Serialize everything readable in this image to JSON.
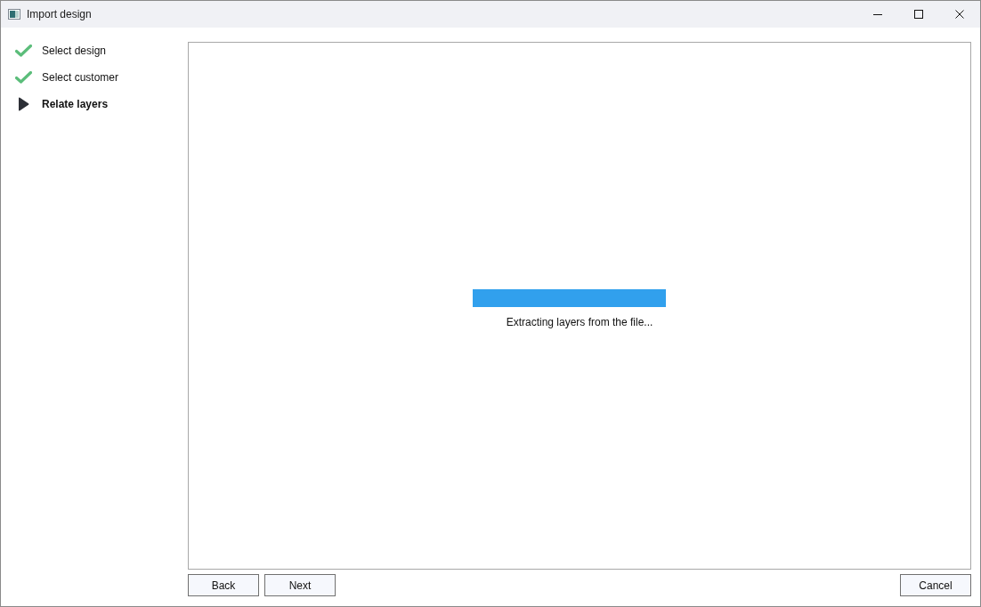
{
  "window": {
    "title": "Import design"
  },
  "steps": [
    {
      "label": "Select design",
      "kind": "done"
    },
    {
      "label": "Select customer",
      "kind": "done"
    },
    {
      "label": "Relate layers",
      "kind": "current"
    }
  ],
  "progress": {
    "level": 1,
    "message": "Extracting layers from the file..."
  },
  "nav_buttons": [
    "Back",
    "Next"
  ],
  "cancel_button": "Cancel"
}
